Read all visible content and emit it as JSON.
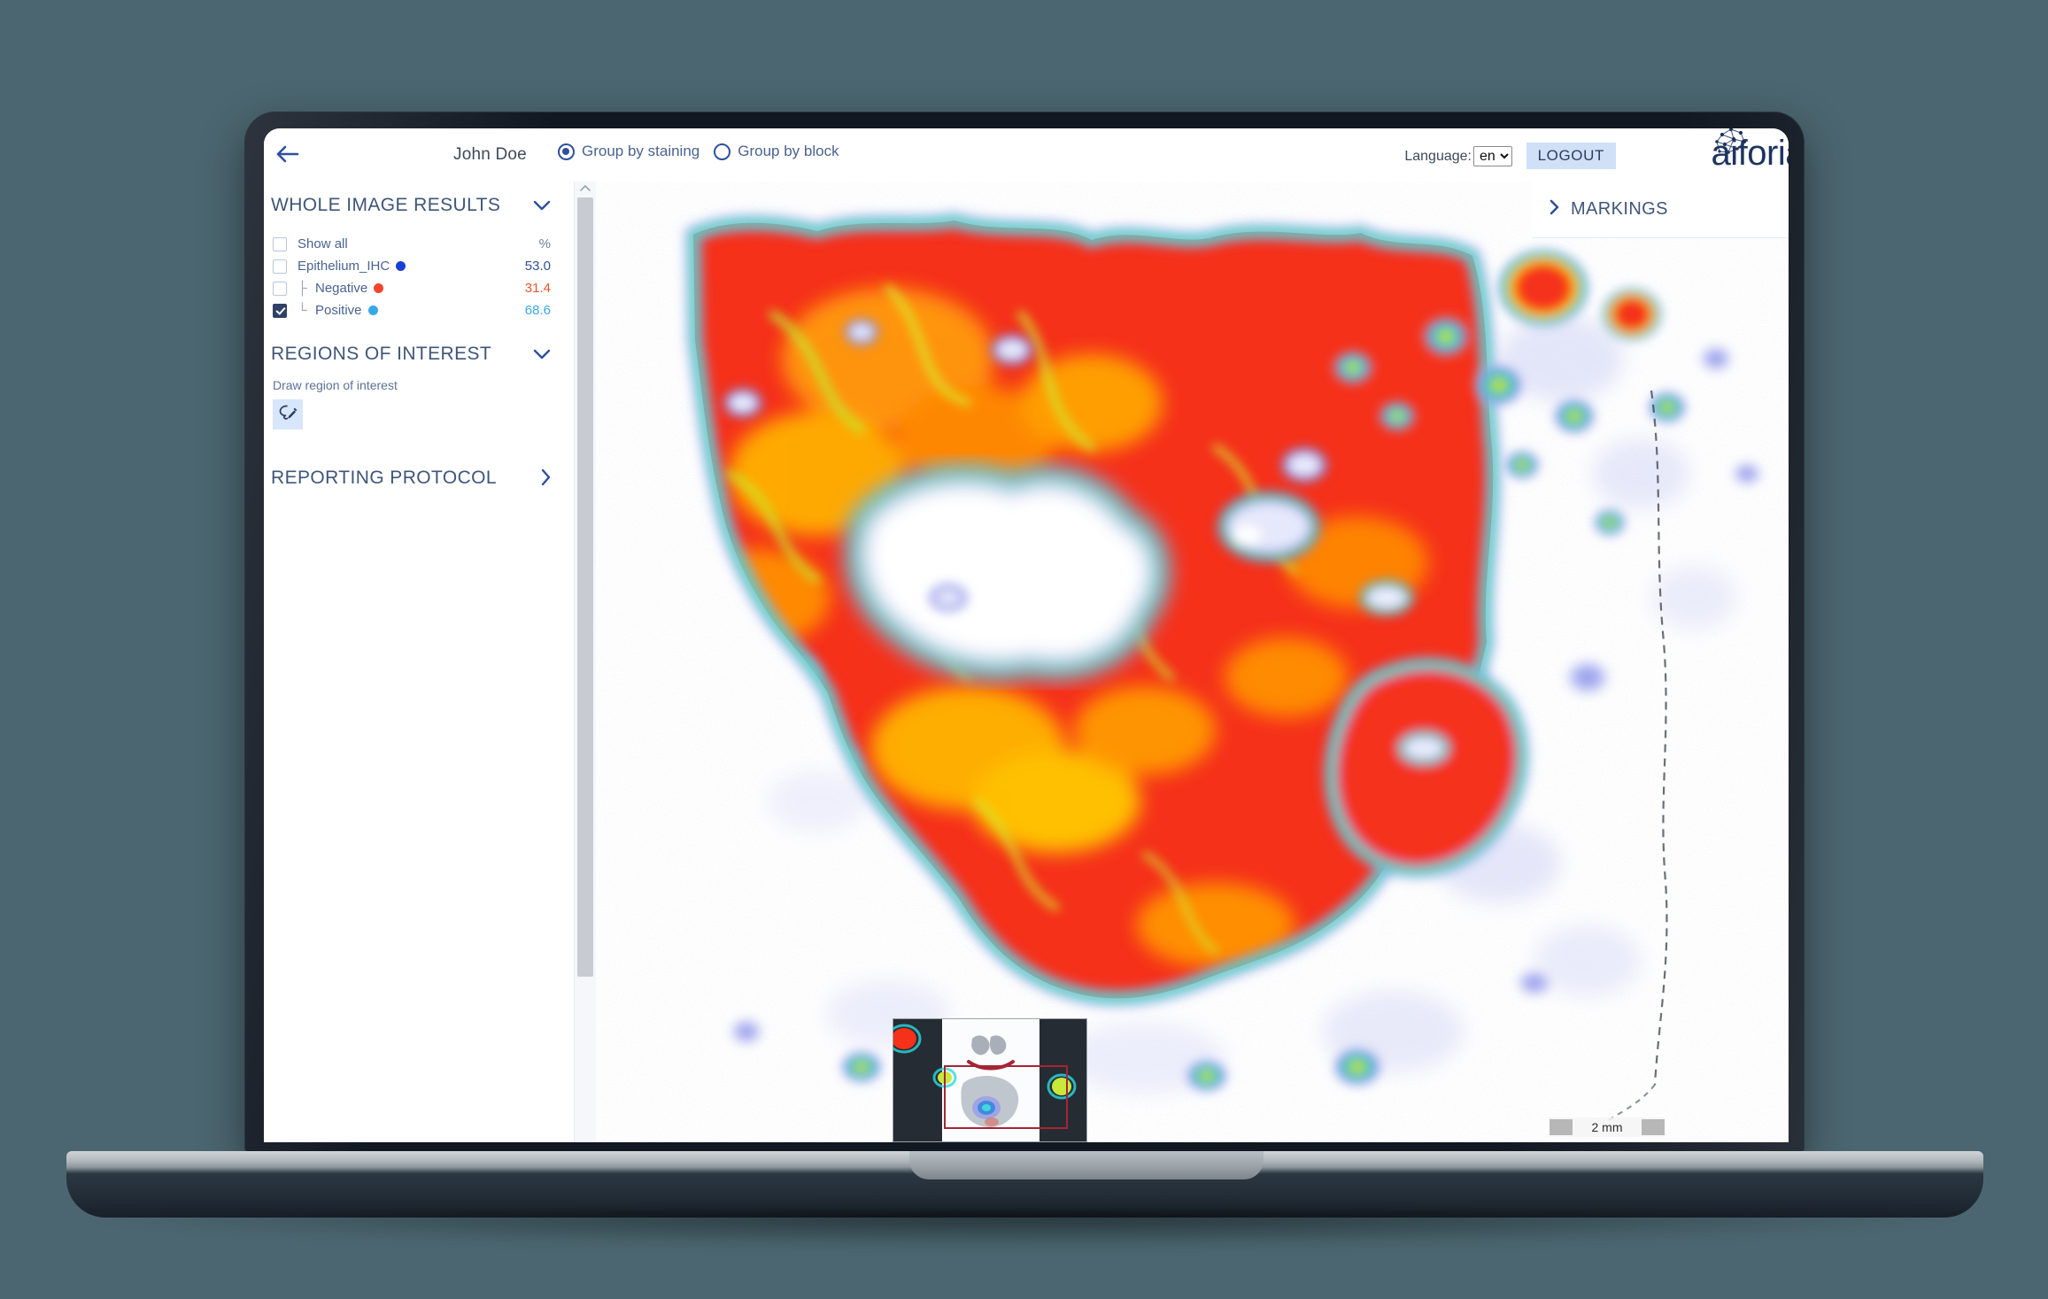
{
  "header": {
    "back_icon": "back-arrow-icon",
    "user_name": "John Doe",
    "group_by_staining": "Group by staining",
    "group_by_block": "Group by block",
    "language_label": "Language:",
    "language_value": "en",
    "language_options": [
      "en"
    ],
    "logout_label": "LOGOUT",
    "brand_name": "aiforia",
    "brand_icon": "aiforia-network-logo-icon"
  },
  "sidebar": {
    "whole_image_results": {
      "title": "WHOLE IMAGE RESULTS",
      "chevron": "chevron-down-icon",
      "header_row": {
        "label": "Show all",
        "value": "%",
        "checked": false
      },
      "rows": [
        {
          "label": "Epithelium_IHC",
          "value": "53.0",
          "checked": false,
          "dot_color": "#1a3fd6",
          "value_color": "#2f4f9e",
          "indent": 0,
          "tree": ""
        },
        {
          "label": "Negative",
          "value": "31.4",
          "checked": false,
          "dot_color": "#f4442e",
          "value_color": "#e8552f",
          "indent": 1,
          "tree": "├"
        },
        {
          "label": "Positive",
          "value": "68.6",
          "checked": true,
          "dot_color": "#3aa7e8",
          "value_color": "#3aa7e8",
          "indent": 1,
          "tree": "└"
        }
      ]
    },
    "regions_of_interest": {
      "title": "REGIONS OF INTEREST",
      "chevron": "chevron-down-icon",
      "hint": "Draw region of interest",
      "draw_icon": "lasso-pencil-icon"
    },
    "reporting_protocol": {
      "title": "REPORTING PROTOCOL",
      "chevron": "chevron-right-icon"
    }
  },
  "viewer": {
    "markings_title": "MARKINGS",
    "markings_chevron": "chevron-right-icon",
    "scale_bar_text": "2 mm",
    "minimap_name": "slide-minimap",
    "colormap": [
      "#ffffff",
      "#b9bdf0",
      "#6f74e0",
      "#1f6fe0",
      "#15c8d8",
      "#3ee07a",
      "#c8f03a",
      "#ffd400",
      "#ff8c00",
      "#f5311a"
    ]
  },
  "colors": {
    "accent_blue": "#2f4f9e",
    "title_slate": "#3f5678",
    "background": "#4b6670"
  }
}
